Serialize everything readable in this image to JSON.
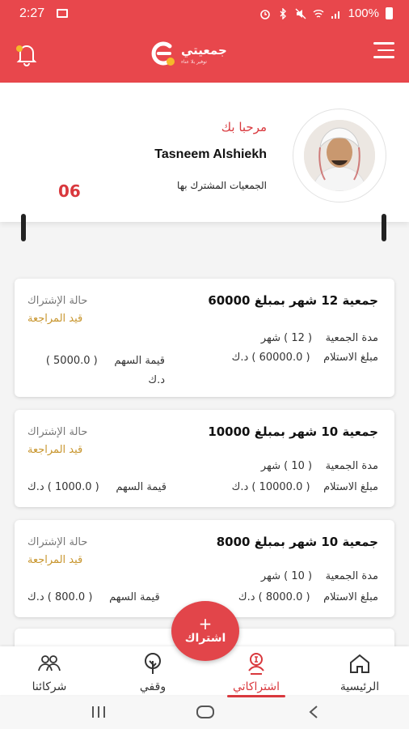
{
  "status_bar": {
    "time": "2:27",
    "battery": "100%"
  },
  "app": {
    "name": "جمعيتي",
    "tagline": "توفير بلا عناء"
  },
  "profile": {
    "welcome": "مرحبا بك",
    "name": "Tasneem Alshiekh",
    "subscribed_label": "الجمعيات المشترك بها",
    "subscribed_count": "06"
  },
  "cards": [
    {
      "title": "جمعية 12 شهر بمبلغ 60000",
      "status_label": "حالة الإشتراك",
      "status_value": "قيد المراجعة",
      "duration_label": "مدة الجمعية",
      "duration_value": "( 12 ) شهر",
      "receive_label": "مبلغ الاستلام",
      "receive_value": "( 60000.0 ) د.ك",
      "share_label": "قيمة السهم",
      "share_value": "( 5000.0 ) د.ك"
    },
    {
      "title": "جمعية 10 شهر بمبلغ 10000",
      "status_label": "حالة الإشتراك",
      "status_value": "قيد المراجعة",
      "duration_label": "مدة الجمعية",
      "duration_value": "( 10 ) شهر",
      "receive_label": "مبلغ الاستلام",
      "receive_value": "( 10000.0 ) د.ك",
      "share_label": "قيمة السهم",
      "share_value": "( 1000.0 ) د.ك"
    },
    {
      "title": "جمعية 10 شهر بمبلغ 8000",
      "status_label": "حالة الإشتراك",
      "status_value": "قيد المراجعة",
      "duration_label": "مدة الجمعية",
      "duration_value": "( 10 ) شهر",
      "receive_label": "مبلغ الاستلام",
      "receive_value": "( 8000.0 ) د.ك",
      "share_label": "قيمة السهم",
      "share_value": "( 800.0 ) د.ك"
    }
  ],
  "fab": {
    "plus": "+",
    "label": "اشتراك"
  },
  "bottom_nav": {
    "home": "الرئيسية",
    "subscriptions": "اشتراكاتي",
    "waqfi": "وقفي",
    "partners": "شركائنا"
  },
  "colors": {
    "primary": "#e8474c",
    "pending": "#c8962f"
  }
}
